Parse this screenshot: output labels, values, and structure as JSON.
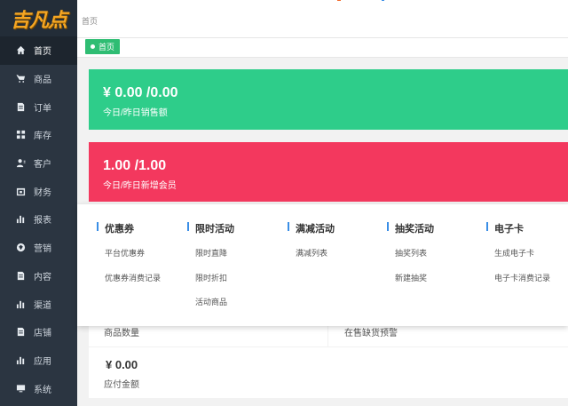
{
  "app": {
    "logo_text": "吉凡点"
  },
  "sidebar": {
    "items": [
      {
        "label": "首页",
        "icon": "home-icon"
      },
      {
        "label": "商品",
        "icon": "cart-icon"
      },
      {
        "label": "订单",
        "icon": "order-icon"
      },
      {
        "label": "库存",
        "icon": "grid-icon"
      },
      {
        "label": "客户",
        "icon": "customer-icon"
      },
      {
        "label": "财务",
        "icon": "wallet-icon"
      },
      {
        "label": "报表",
        "icon": "bar-chart-icon"
      },
      {
        "label": "营销",
        "icon": "marketing-icon"
      },
      {
        "label": "内容",
        "icon": "document-icon"
      },
      {
        "label": "渠道",
        "icon": "bar-chart-icon"
      },
      {
        "label": "店铺",
        "icon": "store-icon"
      },
      {
        "label": "应用",
        "icon": "bar-chart-icon"
      },
      {
        "label": "系统",
        "icon": "monitor-icon"
      }
    ],
    "active_index": 0
  },
  "header": {
    "breadcrumb": "首页"
  },
  "tabs": [
    {
      "label": "首页"
    }
  ],
  "stats": {
    "sales": {
      "value": "¥ 0.00 /0.00",
      "label": "今日/昨日销售额"
    },
    "members": {
      "value": "1.00 /1.00",
      "label": "今日/昨日新增会员"
    }
  },
  "panels": {
    "product_count_label": "商品数量",
    "stock_alert_label": "在售缺货预警",
    "payable_value": "¥ 0.00",
    "payable_label": "应付金额"
  },
  "mega_menu": {
    "columns": [
      {
        "title": "优惠券",
        "links": [
          "平台优惠券",
          "优惠券消费记录"
        ]
      },
      {
        "title": "限时活动",
        "links": [
          "限时直降",
          "限时折扣",
          "活动商品"
        ]
      },
      {
        "title": "满减活动",
        "links": [
          "满减列表"
        ]
      },
      {
        "title": "抽奖活动",
        "links": [
          "抽奖列表",
          "新建抽奖"
        ]
      },
      {
        "title": "电子卡",
        "links": [
          "生成电子卡",
          "电子卡消费记录"
        ]
      }
    ]
  },
  "colors": {
    "sidebar_bg": "#2b3541",
    "logo_color": "#f5a623",
    "tab_green": "#2fbd73",
    "sales_card": "#2ecd8a",
    "members_card": "#f3385e",
    "menu_accent": "#3a8ee6"
  }
}
